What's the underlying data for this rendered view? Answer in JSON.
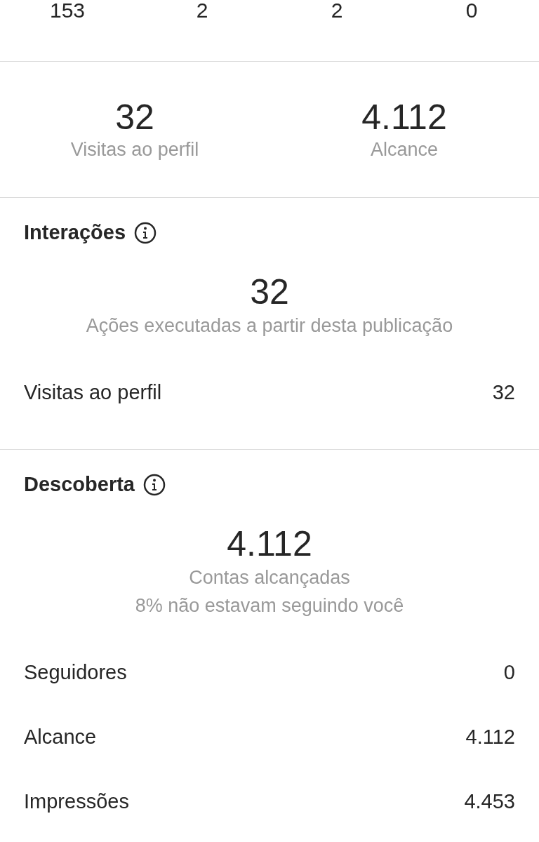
{
  "top_counts": [
    "153",
    "2",
    "2",
    "0"
  ],
  "summary": [
    {
      "value": "32",
      "label": "Visitas ao perfil"
    },
    {
      "value": "4.112",
      "label": "Alcance"
    }
  ],
  "sections": [
    {
      "title": "Interações",
      "total": "32",
      "captions": [
        "Ações executadas a partir desta publicação"
      ],
      "rows": [
        {
          "label": "Visitas ao perfil",
          "value": "32",
          "kind": "main"
        }
      ]
    },
    {
      "title": "Descoberta",
      "total": "4.112",
      "captions": [
        "Contas alcançadas",
        "8% não estavam seguindo você"
      ],
      "rows": [
        {
          "label": "Seguidores",
          "value": "0",
          "kind": "main"
        },
        {
          "label": "Alcance",
          "value": "4.112",
          "kind": "main"
        },
        {
          "label": "Impressões",
          "value": "4.453",
          "kind": "main"
        }
      ]
    }
  ]
}
